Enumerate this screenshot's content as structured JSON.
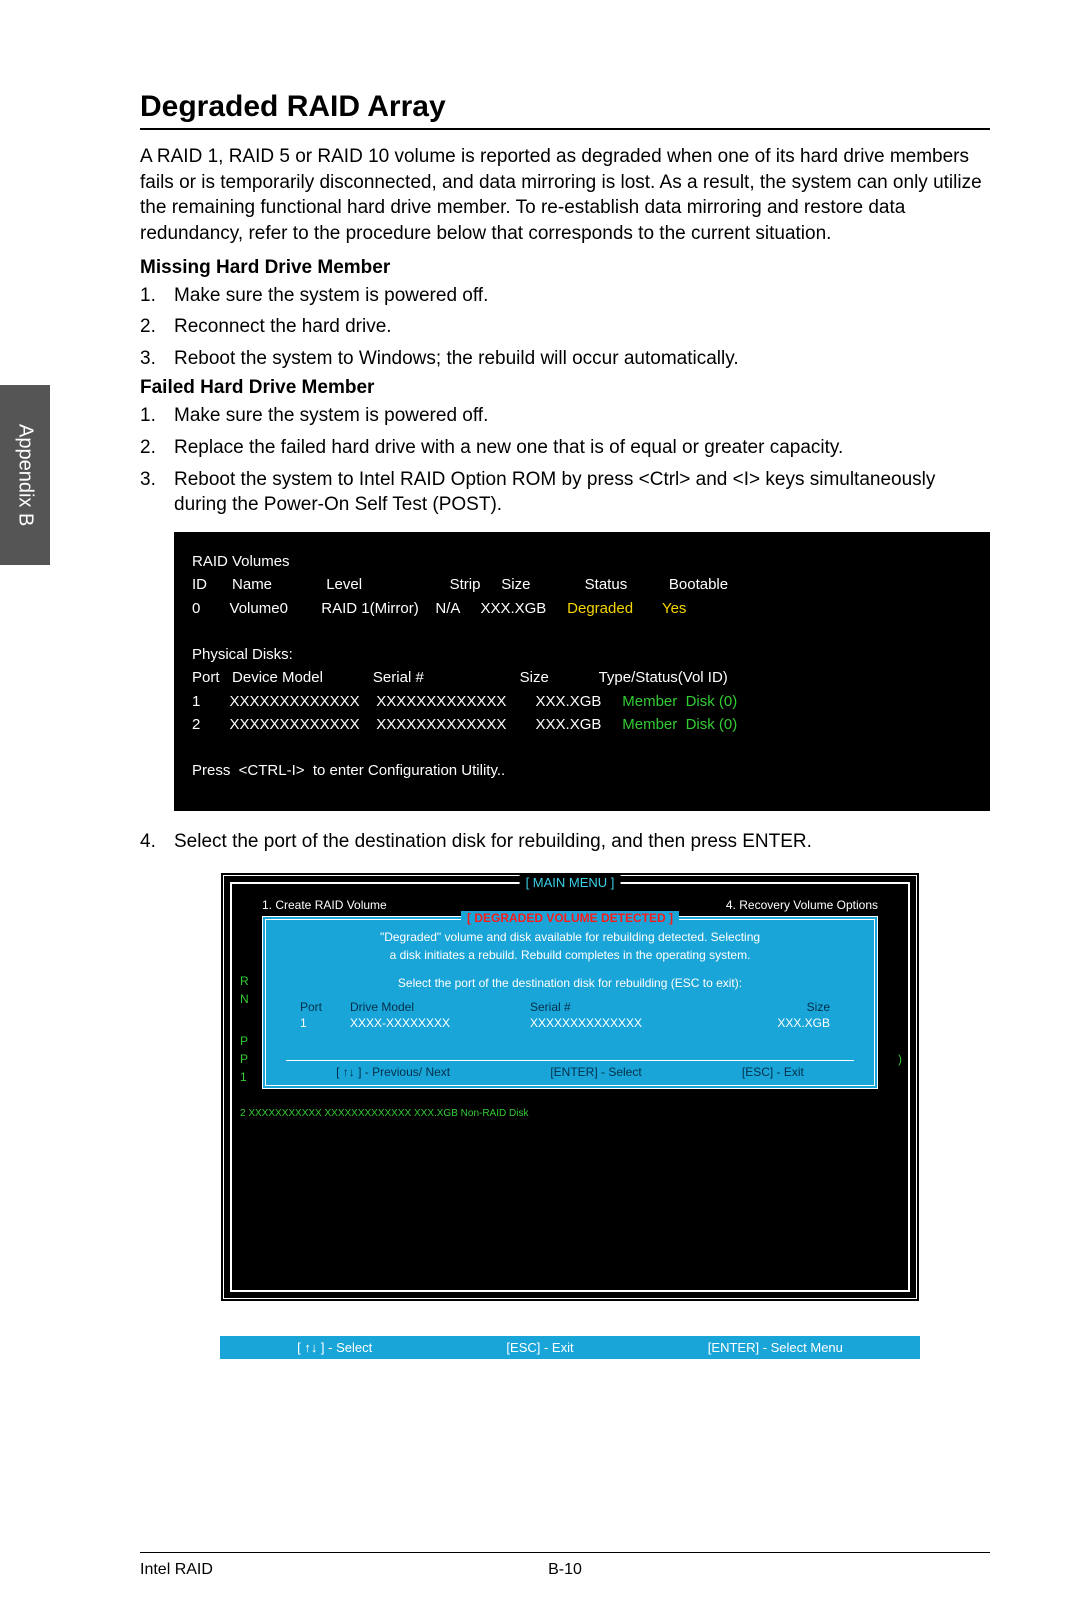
{
  "side_tab": "Appendix B",
  "title": "Degraded RAID Array",
  "intro": "A RAID 1, RAID 5 or RAID 10 volume is reported as degraded when one of its hard drive members fails or is temporarily disconnected, and data mirroring is lost. As a result, the system can only utilize the remaining functional hard drive member. To re-establish data mirroring and restore data redundancy, refer to the procedure below that corresponds to the current situation.",
  "section1_title": "Missing Hard Drive Member",
  "section1_steps": {
    "s1": "Make sure the system is powered off.",
    "s2": "Reconnect the hard drive.",
    "s3": "Reboot the system to Windows; the rebuild will occur automatically."
  },
  "section2_title": "Failed Hard Drive Member",
  "section2_steps": {
    "s1": "Make sure the system is powered off.",
    "s2": "Replace the failed hard drive with a new one that is of equal or greater capacity.",
    "s3": "Reboot the system to Intel RAID Option ROM by press <Ctrl> and <I> keys simultaneously during the Power-On Self Test (POST).",
    "s4": "Select the port of the destination disk for rebuilding, and then press ENTER."
  },
  "bios1": {
    "raid_volumes": "RAID Volumes",
    "hdr": {
      "id": "ID",
      "name": "Name",
      "level": "Level",
      "strip": "Strip",
      "size": "Size",
      "status": "Status",
      "bootable": "Bootable"
    },
    "row": {
      "id": "0",
      "name": "Volume0",
      "level": "RAID 1(Mirror)",
      "strip": "N/A",
      "size": "XXX.XGB",
      "status": "Degraded",
      "bootable": "Yes"
    },
    "physical_disks": "Physical Disks:",
    "phdr": {
      "port": "Port",
      "model": "Device Model",
      "serial": "Serial #",
      "size": "Size",
      "type": "Type/Status(Vol ID)"
    },
    "prow1": {
      "port": "1",
      "model": "XXXXXXXXXXXXX",
      "serial": "XXXXXXXXXXXXX",
      "size": "XXX.XGB",
      "type": "Member  Disk (0)"
    },
    "prow2": {
      "port": "2",
      "model": "XXXXXXXXXXXXX",
      "serial": "XXXXXXXXXXXXX",
      "size": "XXX.XGB",
      "type": "Member  Disk (0)"
    },
    "press": "Press  <CTRL-I>  to enter Configuration Utility.."
  },
  "bios2": {
    "main_menu": "[  MAIN  MENU   ]",
    "menu_left": "1.      Create  RAID  Volume",
    "menu_right": "4.      Recovery Volume  Options",
    "dialog_title": "[  DEGRADED VOLUME DETECTED  ]",
    "line1": "\"Degraded\" volume and disk available for rebuilding detected. Selecting",
    "line2": "a disk initiates a rebuild. Rebuild completes in the  operating system.",
    "line3": "Select the port of the destination disk for rebuilding (ESC to exit):",
    "thdr": {
      "port": "Port",
      "model": "Drive  Model",
      "serial": "Serial  #",
      "size": "Size"
    },
    "trow": {
      "port": "1",
      "model": "XXXX-XXXXXXXX",
      "serial": "XXXXXXXXXXXXXX",
      "size": "XXX.XGB"
    },
    "foot": {
      "a": "[ ↑↓ ] - Previous/ Next",
      "b": "[ENTER] - Select",
      "c": "[ESC] - Exit"
    },
    "bg_bottom": "2     XXXXXXXXXXX        XXXXXXXXXXXXX                    XXX.XGB    Non-RAID  Disk"
  },
  "footer_bar": {
    "a": "[ ↑↓ ] - Select",
    "b": "[ESC] - Exit",
    "c": "[ENTER] - Select Menu"
  },
  "footer": {
    "left": "Intel RAID",
    "page": "B-10"
  }
}
